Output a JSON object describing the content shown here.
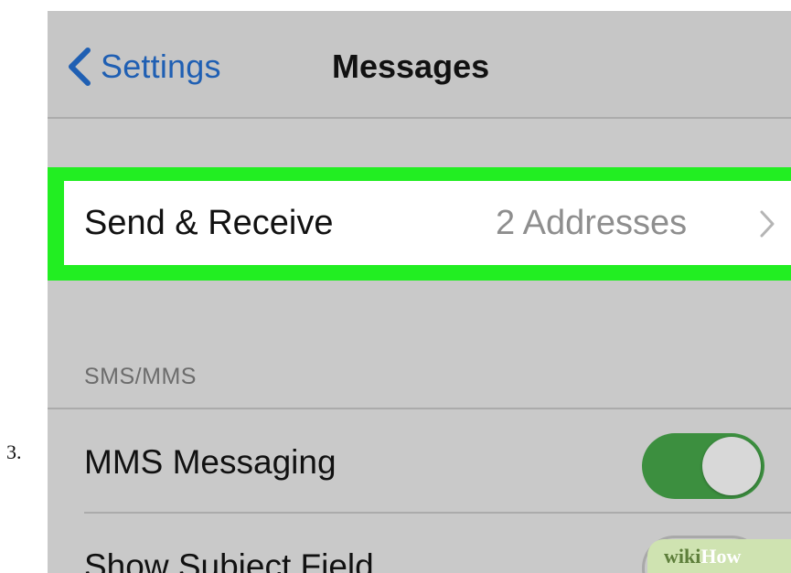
{
  "step": {
    "number": "3."
  },
  "navbar": {
    "back_label": "Settings",
    "title": "Messages"
  },
  "send_receive": {
    "label": "Send & Receive",
    "value": "2 Addresses",
    "highlight_color": "#22ee22"
  },
  "sms_section": {
    "header": "SMS/MMS",
    "rows": [
      {
        "label": "MMS Messaging",
        "toggle_on": true
      },
      {
        "label": "Show Subject Field",
        "toggle_on": false
      }
    ]
  },
  "colors": {
    "accent": "#1f5fb3",
    "toggle_on": "#3c8f3f"
  },
  "watermark": {
    "part1": "wiki",
    "part2": "How"
  }
}
